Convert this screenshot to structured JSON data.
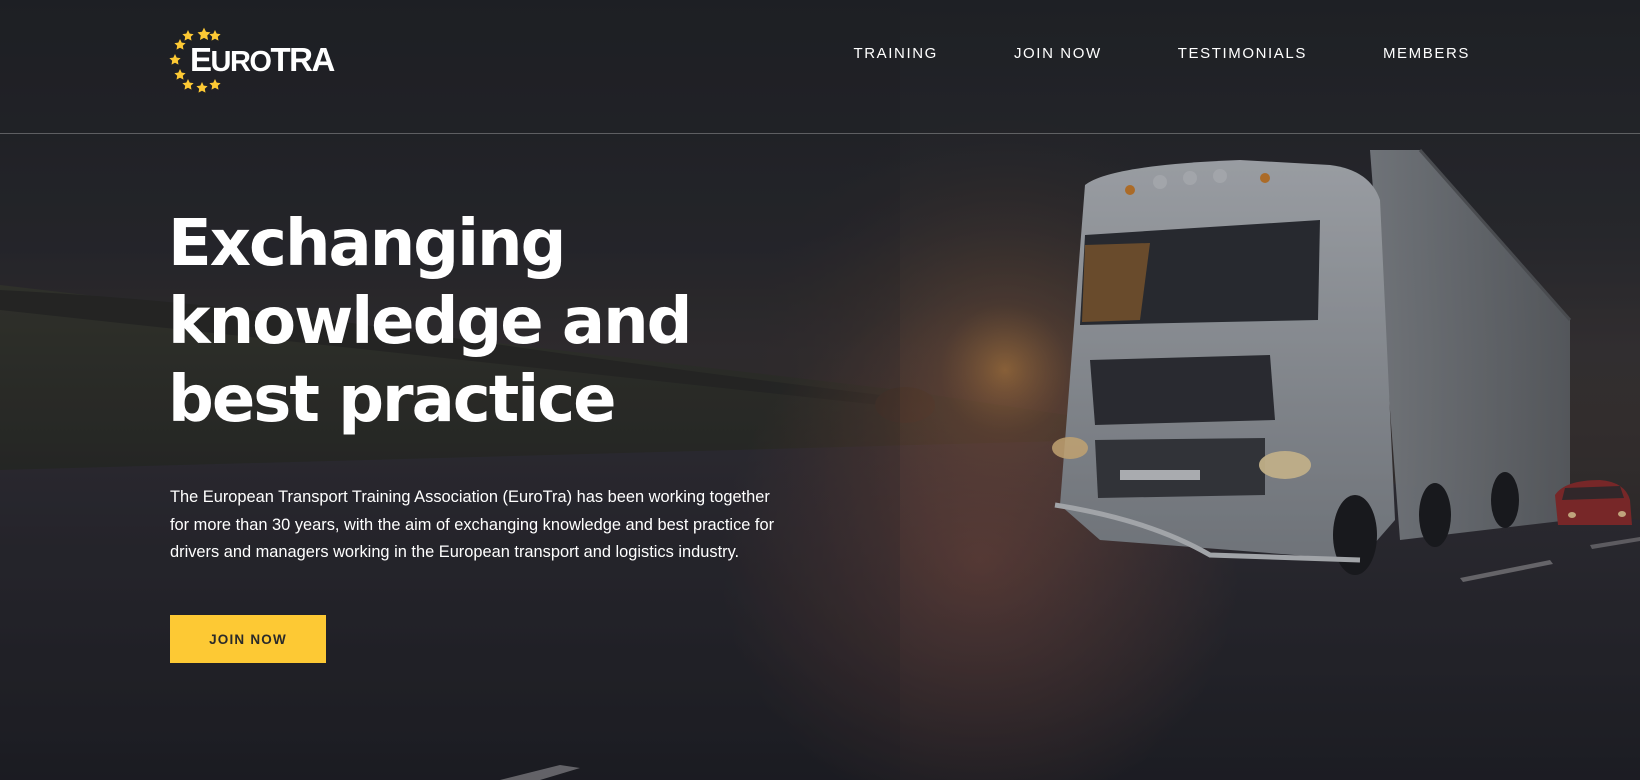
{
  "brand": {
    "logo_text_first": "E",
    "logo_text_rest": "URO",
    "logo_text_end": "TRA",
    "star_color": "#fdc934"
  },
  "nav": {
    "items": [
      {
        "label": "TRAINING",
        "icon": ""
      },
      {
        "label": "JOIN NOW",
        "icon": ""
      },
      {
        "label": "TESTIMONIALS",
        "icon": ""
      },
      {
        "label": "MEMBERS",
        "icon": ""
      }
    ]
  },
  "hero": {
    "title_lines": [
      "Exchanging",
      "knowledge and",
      "best practice"
    ],
    "description_lines": [
      "The European Transport Training Association (EuroTra) has been working together",
      "for more than 30 years, with the aim of exchanging knowledge and best practice for",
      "drivers and managers working in the European transport and logistics industry."
    ],
    "cta_label": "JOIN NOW",
    "background_image": "truck-on-highway-at-sunset"
  },
  "colors": {
    "accent": "#fdc934",
    "text": "#ffffff",
    "background": "#222428"
  }
}
